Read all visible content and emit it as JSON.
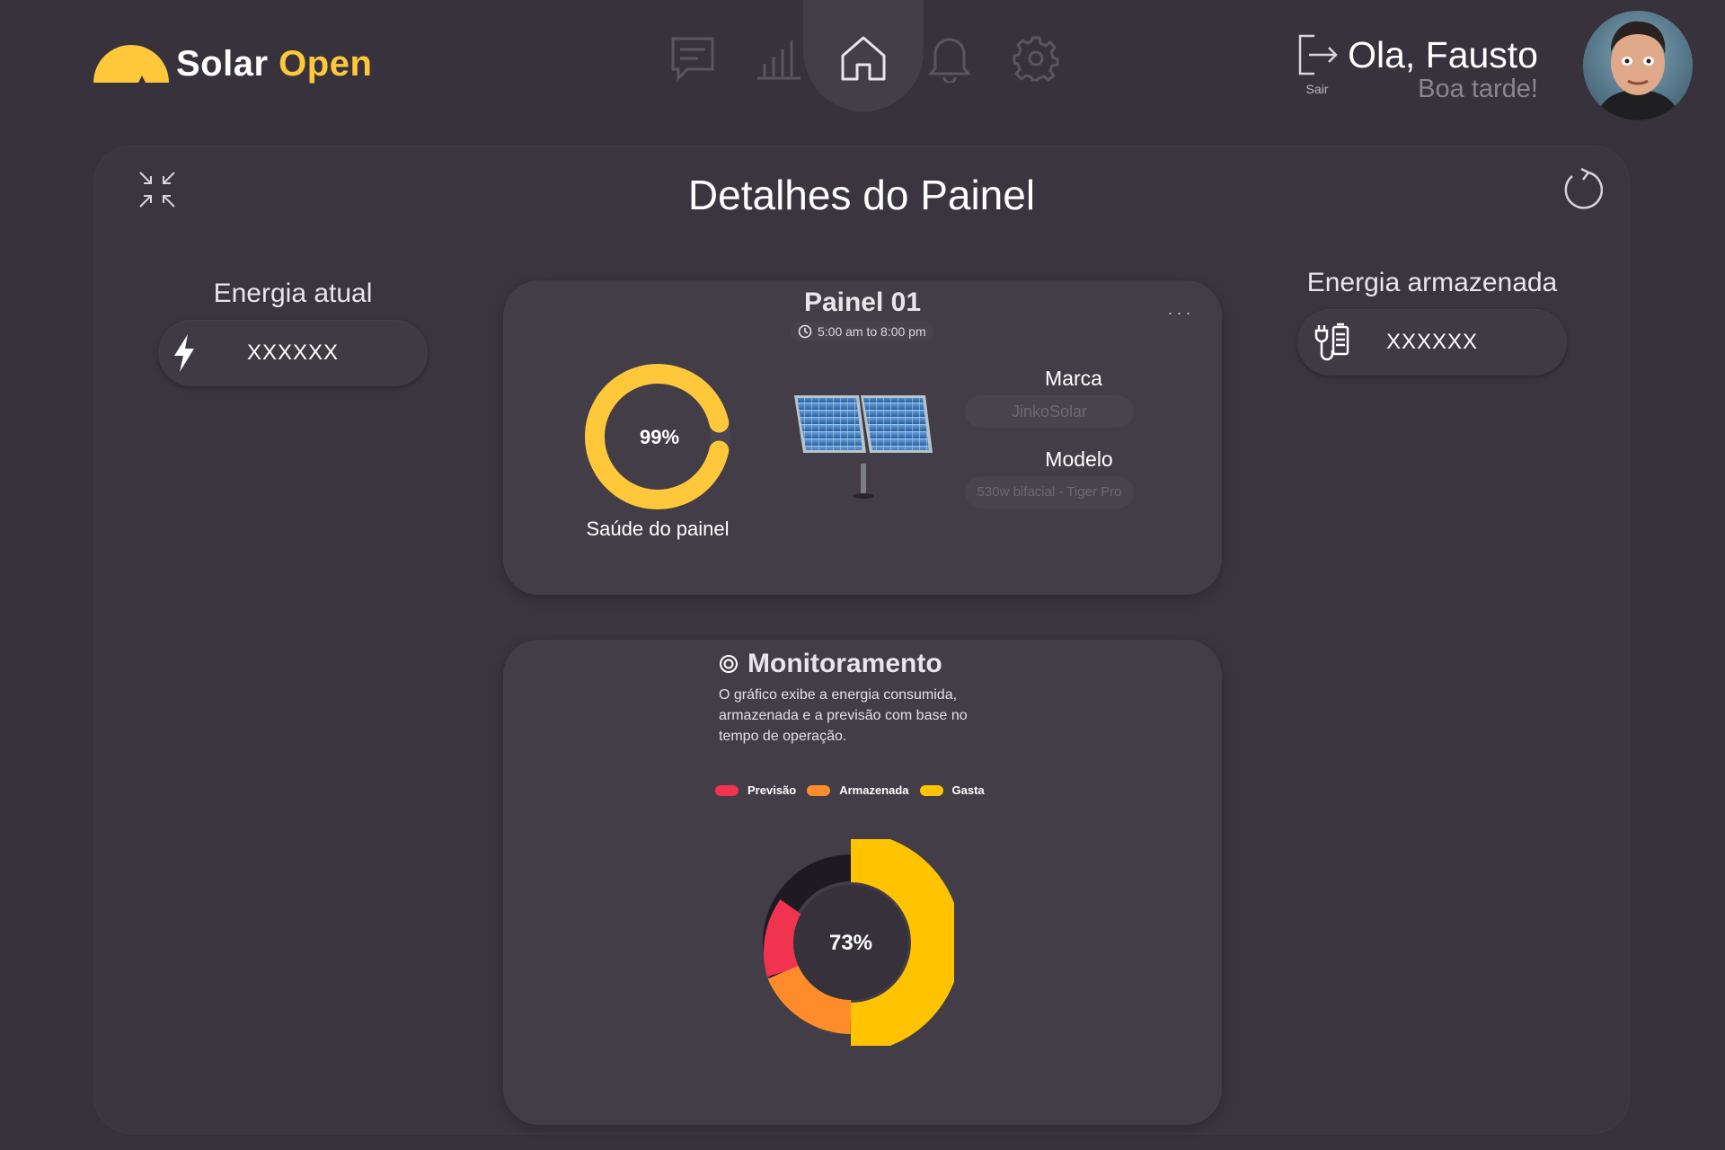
{
  "brand": {
    "word1": "Solar",
    "word2": "Open"
  },
  "nav": {
    "items": [
      {
        "id": "messages",
        "icon": "chat-icon"
      },
      {
        "id": "reports",
        "icon": "bar-chart-icon"
      },
      {
        "id": "home",
        "icon": "home-icon",
        "active": true
      },
      {
        "id": "notifications",
        "icon": "bell-icon"
      },
      {
        "id": "settings",
        "icon": "gear-icon"
      }
    ]
  },
  "header": {
    "logout_label": "Sair",
    "greeting": "Ola, Fausto",
    "subgreeting": "Boa tarde!"
  },
  "page": {
    "title": "Detalhes do Painel"
  },
  "energy_current": {
    "title": "Energia atual",
    "value": "XXXXXX"
  },
  "energy_stored": {
    "title": "Energia armazenada",
    "value": "XXXXXX"
  },
  "panel": {
    "title": "Painel 01",
    "more": "...",
    "time_range": "5:00 am to 8:00 pm",
    "health_value": "99%",
    "health_fraction": 0.99,
    "health_label": "Saúde do painel",
    "brand_label": "Marca",
    "brand_value": "JinkoSolar",
    "model_label": "Modelo",
    "model_value": "530w bifacial - Tiger Pro"
  },
  "monitoring": {
    "title": "Monitoramento",
    "description": "O gráfico exibe a energia consumida, armazenada e a previsão com base no tempo de operação.",
    "center_value": "73%",
    "legend": [
      {
        "label": "Previsão",
        "color": "#f0334e"
      },
      {
        "label": "Armazenada",
        "color": "#ff8c2a"
      },
      {
        "label": "Gasta",
        "color": "#ffc300"
      }
    ]
  },
  "colors": {
    "accent": "#ffc83a",
    "background": "#37323b",
    "card": "#423d46"
  }
}
